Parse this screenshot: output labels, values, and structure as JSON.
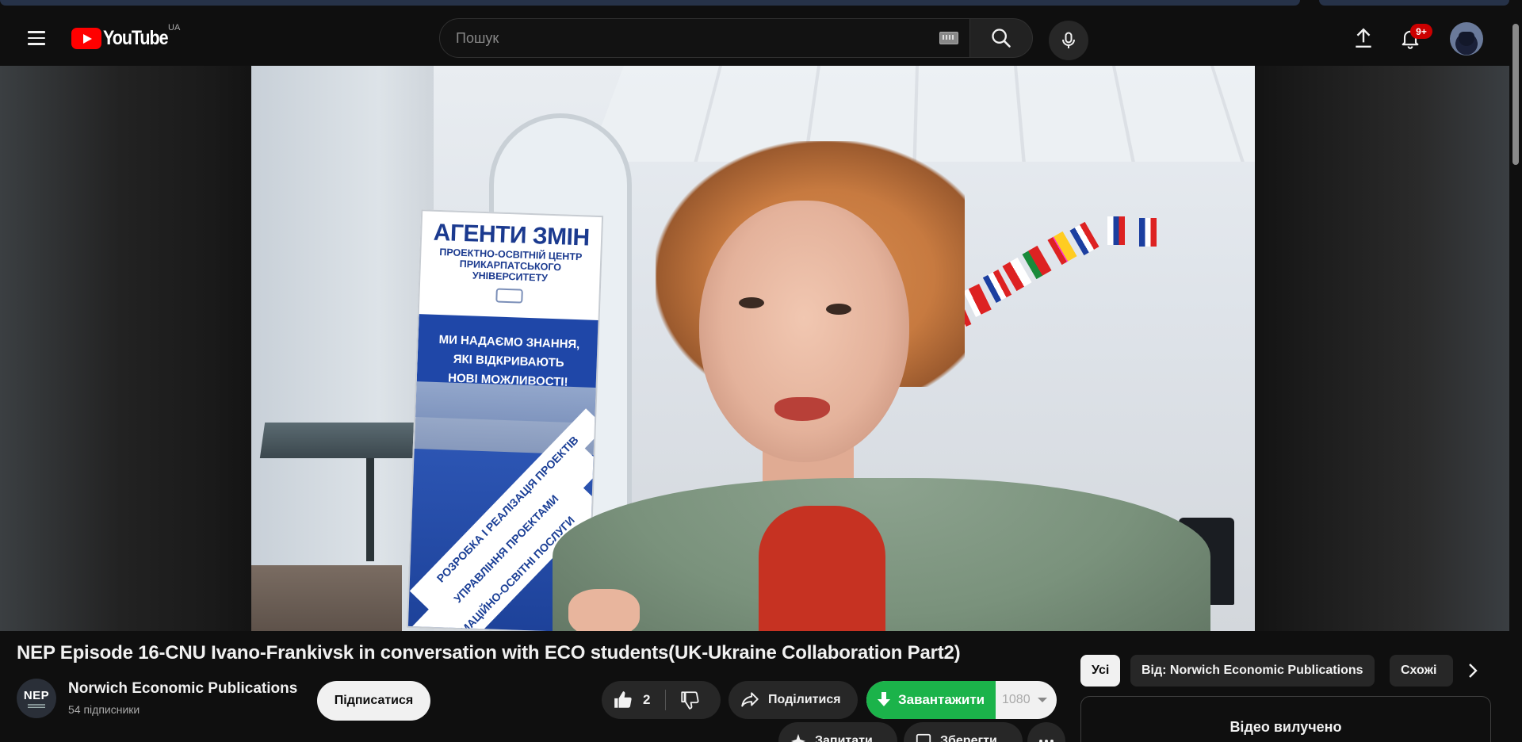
{
  "header": {
    "logo_text": "YouTube",
    "region": "UA",
    "search_placeholder": "Пошук",
    "notification_count": "9+"
  },
  "video_frame_text": {
    "banner_title": "АГЕНТИ ЗМІН",
    "banner_subtitle_1": "ПРОЕКТНО-ОСВІТНІЙ ЦЕНТР",
    "banner_subtitle_2": "ПРИКАРПАТСЬКОГО УНІВЕРСИТЕТУ",
    "banner_tagline_1": "МИ НАДАЄМО ЗНАННЯ,",
    "banner_tagline_2": "ЯКІ ВІДКРИВАЮТЬ",
    "banner_tagline_3": "НОВІ МОЖЛИВОСТІ!",
    "banner_stripe_1": "РОЗРОБКА І РЕАЛІЗАЦІЯ ПРОЕКТІВ",
    "banner_stripe_2": "УПРАВЛІННЯ ПРОЕКТАМИ",
    "banner_stripe_3": "ІНФОРМАЦІЙНО-ОСВІТНІ ПОСЛУГИ"
  },
  "video": {
    "title": "NEP Episode 16-CNU Ivano-Frankivsk in conversation with ECO students(UK-Ukraine Collaboration Part2)",
    "channel_name": "Norwich Economic Publications",
    "channel_avatar_text": "NEP",
    "subscribers": "54 підписники",
    "subscribe_label": "Підписатися",
    "like_count": "2",
    "share_label": "Поділитися",
    "download_label": "Завантажити",
    "download_quality": "1080",
    "ask_label": "Запитати",
    "save_label": "Зберегти"
  },
  "sidebar": {
    "chips": [
      "Усі",
      "Від: Norwich Economic Publications",
      "Схожі"
    ],
    "removed_message": "Відео вилучено"
  },
  "colors": {
    "background": "#0f0f0f",
    "brand_red": "#ff0000",
    "download_green": "#1bb34a",
    "pill_bg": "#272727"
  }
}
